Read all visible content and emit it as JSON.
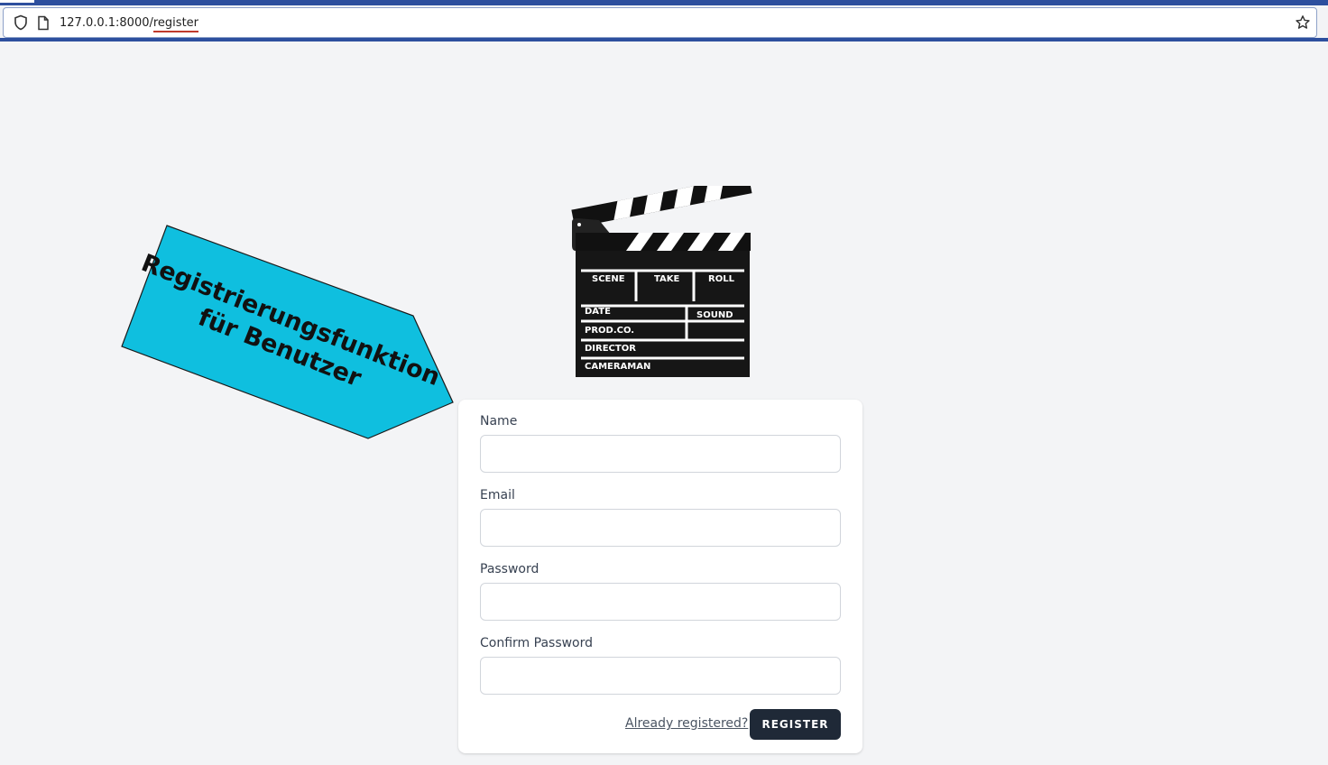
{
  "browser": {
    "url_host": "127.0.0.1:8000/",
    "url_path": "register",
    "icons": [
      "shield-icon",
      "page-icon",
      "bookmark-star-icon"
    ]
  },
  "callout": {
    "line1": "Registrierungsfunktion",
    "line2": "für Benutzer",
    "color": "#0fbfdf"
  },
  "clapperboard": {
    "fields": [
      "SCENE",
      "TAKE",
      "ROLL",
      "DATE",
      "SOUND",
      "PROD.CO.",
      "DIRECTOR",
      "CAMERAMAN"
    ]
  },
  "form": {
    "name_label": "Name",
    "email_label": "Email",
    "password_label": "Password",
    "confirm_password_label": "Confirm Password",
    "name_value": "",
    "email_value": "",
    "password_value": "",
    "confirm_password_value": "",
    "already_registered_link": "Already registered?",
    "register_button": "REGISTER",
    "button_color": "#1f2937"
  }
}
